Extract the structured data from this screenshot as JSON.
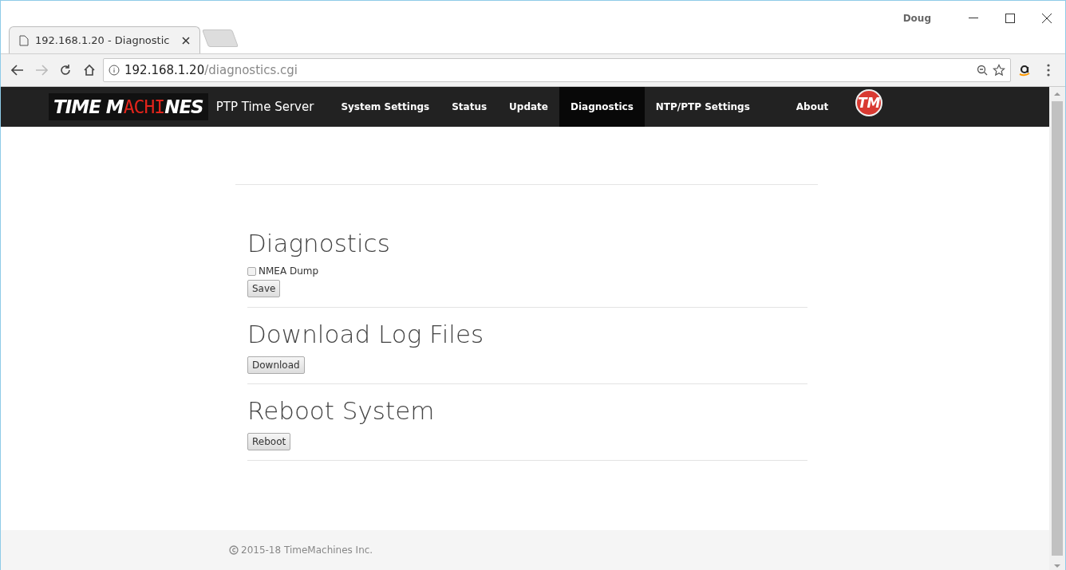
{
  "browser": {
    "tab_title": "192.168.1.20 - Diagnostic",
    "profile": "Doug",
    "url_host": "192.168.1.20",
    "url_path": "/diagnostics.cgi"
  },
  "navbar": {
    "logo": {
      "prefix": "TIME M",
      "highlight": "ACHI",
      "suffix": "NES"
    },
    "brand": "PTP Time Server",
    "badge": "TM",
    "items": [
      {
        "label": "System Settings",
        "selected": false
      },
      {
        "label": "Status",
        "selected": false
      },
      {
        "label": "Update",
        "selected": false
      },
      {
        "label": "Diagnostics",
        "selected": true
      },
      {
        "label": "NTP/PTP Settings",
        "selected": false
      },
      {
        "label": "About",
        "selected": false
      }
    ]
  },
  "sections": [
    {
      "title": "Diagnostics",
      "checkbox": {
        "label": "NMEA Dump",
        "checked": false
      },
      "button": "Save"
    },
    {
      "title": "Download Log Files",
      "button": "Download"
    },
    {
      "title": "Reboot System",
      "button": "Reboot"
    }
  ],
  "footer": {
    "text": "2015-18 TimeMachines Inc."
  }
}
